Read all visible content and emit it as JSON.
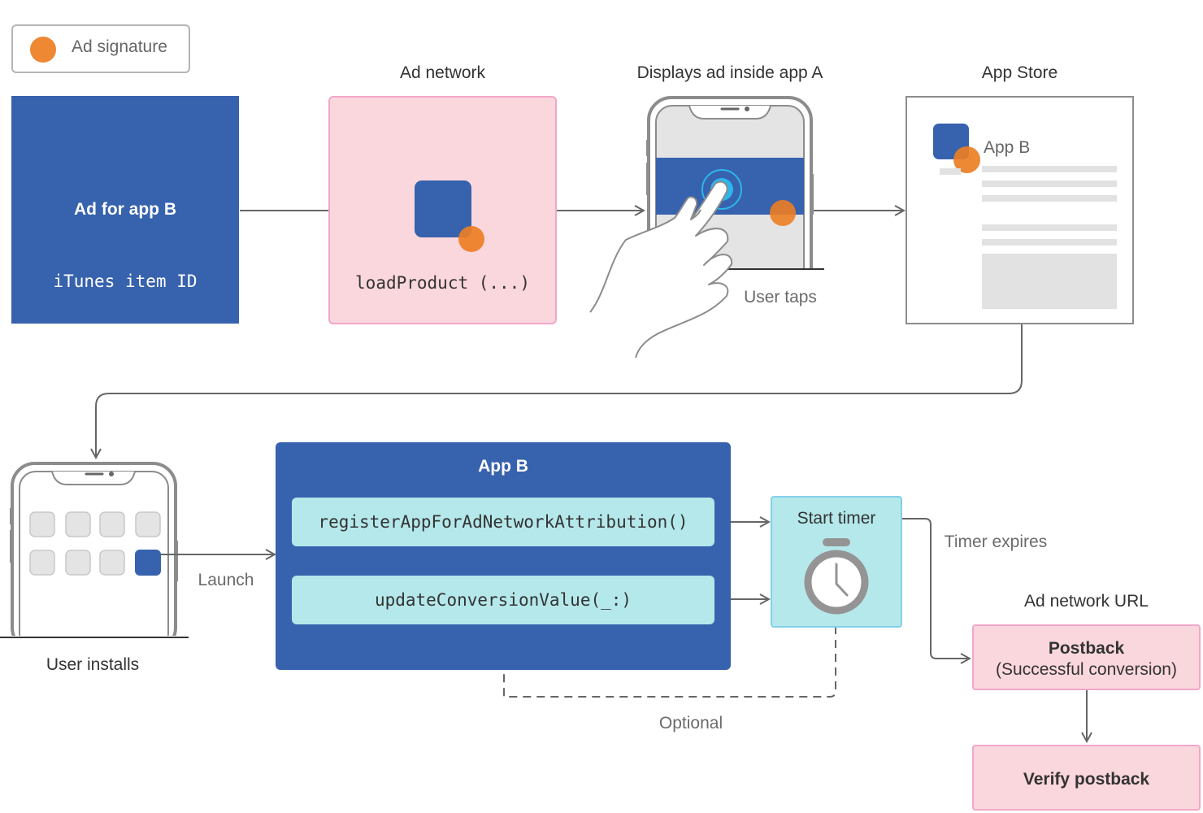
{
  "legend": {
    "label": "Ad signature",
    "color": "#ee8833"
  },
  "colors": {
    "brand_blue": "#3762ad",
    "signature_orange": "#ee8833",
    "network_pink": "#fad7dd",
    "method_cyan": "#b5e8eb",
    "tap_highlight": "#2eb6ea",
    "connector_gray": "#666666"
  },
  "stages": {
    "ad": {
      "title": "Ad for app B",
      "id_label": "iTunes item ID"
    },
    "ad_network": {
      "heading": "Ad network",
      "call": "loadProduct (...)"
    },
    "display": {
      "heading": "Displays ad inside app A",
      "caption": "User taps"
    },
    "app_store": {
      "heading": "App Store",
      "app_name": "App B"
    },
    "install": {
      "caption": "User installs",
      "launch_label": "Launch"
    },
    "app_b": {
      "title": "App B",
      "methods": [
        "registerAppForAdNetworkAttribution()",
        "updateConversionValue(_:)"
      ]
    },
    "timer": {
      "label": "Start timer",
      "expires_label": "Timer expires",
      "optional_label": "Optional"
    },
    "postback": {
      "heading": "Ad network URL",
      "title": "Postback",
      "subtitle": "(Successful conversion)"
    },
    "verify": {
      "title": "Verify postback"
    }
  }
}
